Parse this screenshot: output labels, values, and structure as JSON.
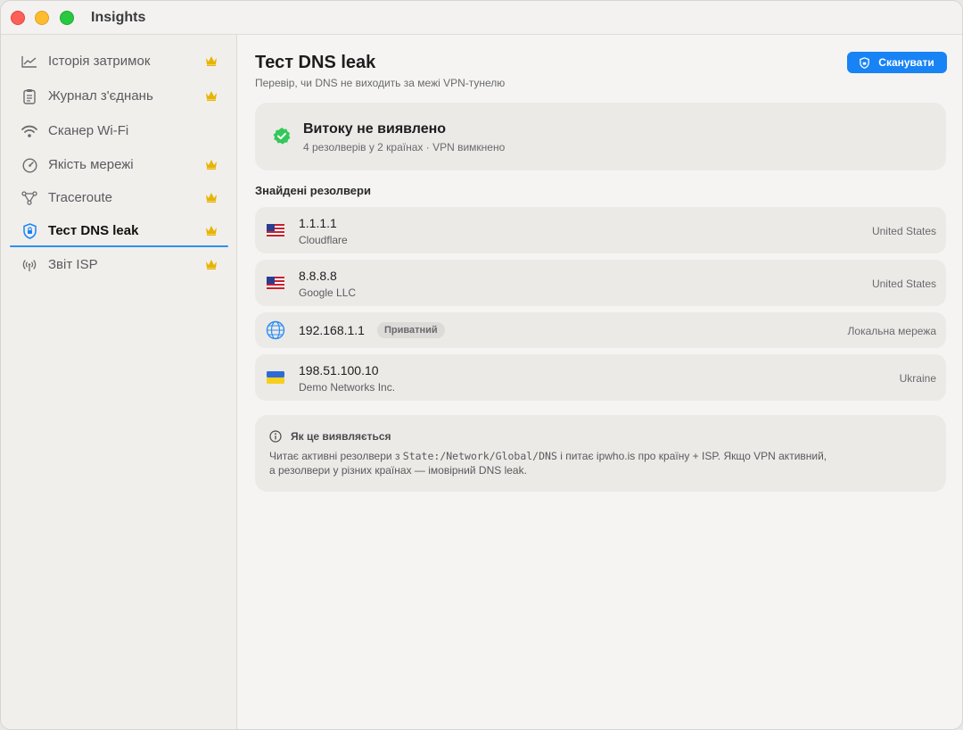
{
  "app": {
    "title": "Insights"
  },
  "sidebar": {
    "items": [
      {
        "label": "Історія затримок",
        "icon": "line-chart-icon",
        "premium": true
      },
      {
        "label": "Журнал з'єднань",
        "icon": "clipboard-icon",
        "premium": true
      },
      {
        "label": "Сканер Wi-Fi",
        "icon": "wifi-icon",
        "premium": false
      },
      {
        "label": "Якість мережі",
        "icon": "gauge-icon",
        "premium": true
      },
      {
        "label": "Traceroute",
        "icon": "network-nodes-icon",
        "premium": true
      },
      {
        "label": "Тест DNS leak",
        "icon": "shield-lock-icon",
        "premium": true,
        "active": true
      },
      {
        "label": "Звіт ISP",
        "icon": "antenna-icon",
        "premium": true
      }
    ]
  },
  "header": {
    "title": "Тест DNS leak",
    "subtitle": "Перевір, чи DNS не виходить за межі VPN-тунелю",
    "scan_label": "Сканувати"
  },
  "status": {
    "title": "Витоку не виявлено",
    "subtitle": "4 резолверів у 2 країнах · VPN вимкнено"
  },
  "resolvers": {
    "section_title": "Знайдені резолвери",
    "items": [
      {
        "ip": "1.1.1.1",
        "org": "Cloudflare",
        "country": "United States",
        "flag": "us-flag-icon"
      },
      {
        "ip": "8.8.8.8",
        "org": "Google LLC",
        "country": "United States",
        "flag": "us-flag-icon"
      },
      {
        "ip": "192.168.1.1",
        "badge": "Приватний",
        "country": "Локальна мережа",
        "flag": "globe-icon"
      },
      {
        "ip": "198.51.100.10",
        "org": "Demo Networks Inc.",
        "country": "Ukraine",
        "flag": "ua-flag-icon"
      }
    ]
  },
  "info": {
    "title": "Як це виявляється",
    "body_pre": "Читає активні резолвери з ",
    "body_code": "State:/Network/Global/DNS",
    "body_post": " і питає ipwho.is про країну + ISP. Якщо VPN активний,",
    "body_line2": "а резолвери у різних країнах — імовірний DNS leak."
  },
  "colors": {
    "accent": "#1883f4",
    "success": "#34c759",
    "premium": "#e8b400"
  }
}
